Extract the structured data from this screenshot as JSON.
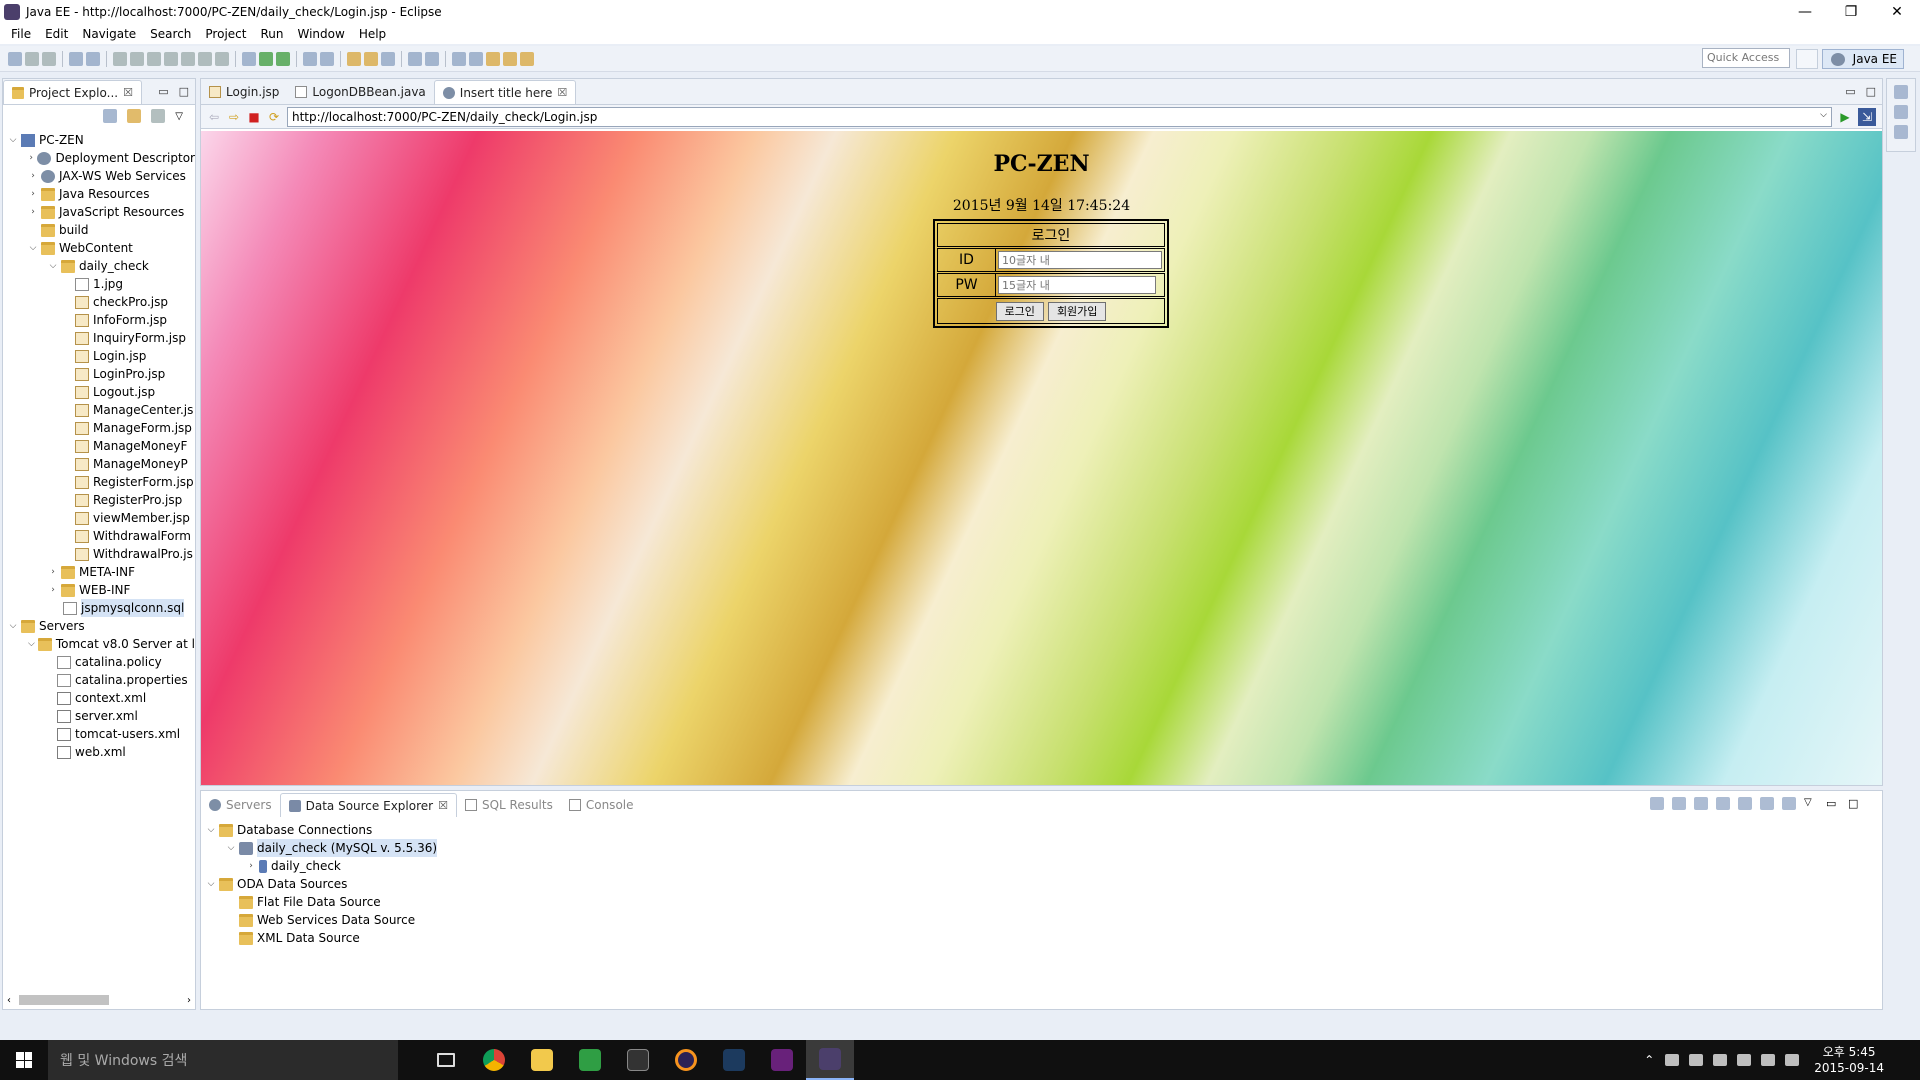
{
  "window": {
    "title": "Java EE - http://localhost:7000/PC-ZEN/daily_check/Login.jsp - Eclipse",
    "minimize": "—",
    "restore": "❐",
    "close": "✕"
  },
  "menu": [
    "File",
    "Edit",
    "Navigate",
    "Search",
    "Project",
    "Run",
    "Window",
    "Help"
  ],
  "toolbar": {
    "quick_access": "Quick Access",
    "perspective": "Java EE"
  },
  "sidebar": {
    "tab_label": "Project Explo...",
    "tree": {
      "label": "PC-ZEN",
      "children": [
        {
          "label": "Deployment Descriptor",
          "icon": "deploy-icon"
        },
        {
          "label": "JAX-WS Web Services",
          "icon": "webservice-icon"
        },
        {
          "label": "Java Resources",
          "icon": "java-resources-icon"
        },
        {
          "label": "JavaScript Resources",
          "icon": "js-resources-icon"
        },
        {
          "label": "build",
          "icon": "folder-icon"
        },
        {
          "label": "WebContent",
          "icon": "folder-icon",
          "children": [
            {
              "label": "daily_check",
              "icon": "folder-icon"
            },
            {
              "label": "META-INF",
              "icon": "folder-icon"
            },
            {
              "label": "WEB-INF",
              "icon": "folder-icon"
            },
            {
              "label": "jspmysqlconn.sql",
              "icon": "sql-file-icon"
            }
          ]
        }
      ]
    },
    "daily_check_files": [
      "1.jpg",
      "checkPro.jsp",
      "InfoForm.jsp",
      "InquiryForm.jsp",
      "Login.jsp",
      "LoginPro.jsp",
      "Logout.jsp",
      "ManageCenter.js",
      "ManageForm.jsp",
      "ManageMoneyF",
      "ManageMoneyP",
      "RegisterForm.jsp",
      "RegisterPro.jsp",
      "viewMember.jsp",
      "WithdrawalForm",
      "WithdrawalPro.js"
    ],
    "servers": {
      "label": "Servers",
      "tomcat": "Tomcat v8.0 Server at l",
      "files": [
        "catalina.policy",
        "catalina.properties",
        "context.xml",
        "server.xml",
        "tomcat-users.xml",
        "web.xml"
      ]
    }
  },
  "editor": {
    "tabs": [
      {
        "label": "Login.jsp"
      },
      {
        "label": "LogonDBBean.java"
      },
      {
        "label": "Insert title here",
        "close": "☒"
      }
    ],
    "url": "http://localhost:7000/PC-ZEN/daily_check/Login.jsp"
  },
  "page": {
    "title": "PC-ZEN",
    "date": "2015년 9월 14일 17:45:24",
    "login_header": "로그인",
    "id_label": "ID",
    "id_placeholder": "10글자 내",
    "pw_label": "PW",
    "pw_placeholder": "15글자 내",
    "login_button": "로그인",
    "register_button": "회원가입"
  },
  "bottom": {
    "tabs": [
      {
        "label": "Servers"
      },
      {
        "label": "Data Source Explorer",
        "close": "☒"
      },
      {
        "label": "SQL Results"
      },
      {
        "label": "Console"
      }
    ],
    "tree": {
      "db_connections": "Database Connections",
      "connection": "daily_check (MySQL v. 5.5.36)",
      "schema": "daily_check",
      "oda": "ODA Data Sources",
      "oda_items": [
        "Flat File Data Source",
        "Web Services Data Source",
        "XML Data Source"
      ]
    }
  },
  "taskbar": {
    "search": "웹 및 Windows 검색",
    "clock_time": "오후 5:45",
    "clock_date": "2015-09-14",
    "apps": [
      "task-view-icon",
      "chrome-icon",
      "file-explorer-icon",
      "vim-icon",
      "cmd-icon",
      "eclipse-icon",
      "mysql-icon",
      "visual-studio-icon",
      "eclipse-active-icon"
    ]
  }
}
